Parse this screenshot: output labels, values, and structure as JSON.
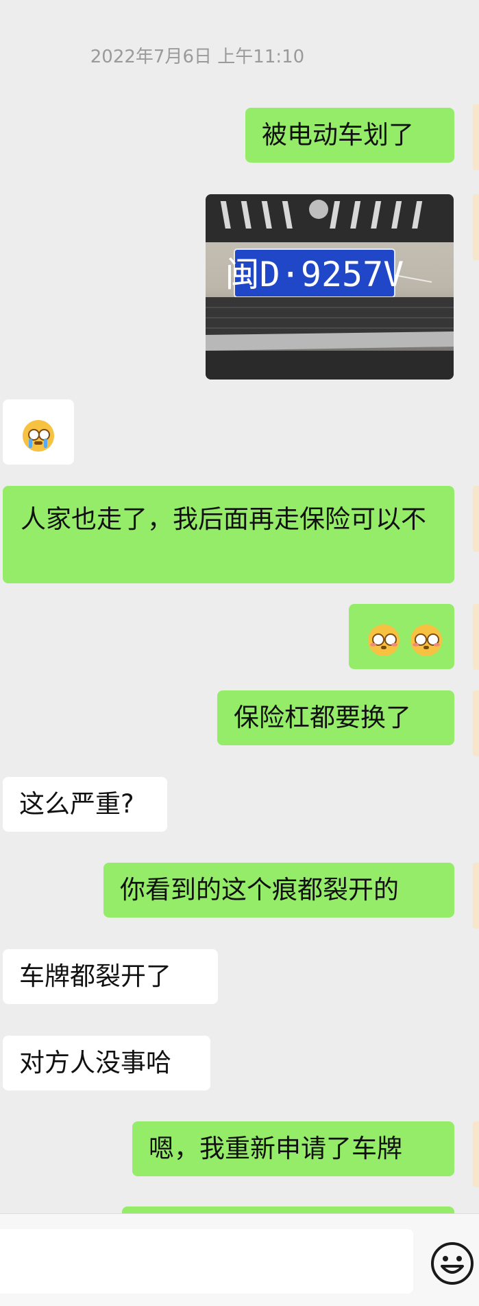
{
  "chat": {
    "timestamp": "2022年7月6日 上午11:10",
    "messages": [
      {
        "side": "out",
        "text": "被电动车划了"
      },
      {
        "side": "out",
        "type": "image",
        "plate_text": "闽D·9257V"
      },
      {
        "side": "in",
        "type": "emoji",
        "emoji_name": "crying-face-icon"
      },
      {
        "side": "out",
        "text": "人家也走了，我后面再走保险可以不"
      },
      {
        "side": "out",
        "type": "emoji",
        "emoji_name": "flushed-face-icon"
      },
      {
        "side": "out",
        "text": "保险杠都要换了"
      },
      {
        "side": "in",
        "text": "这么严重?"
      },
      {
        "side": "out",
        "text": "你看到的这个痕都裂开的"
      },
      {
        "side": "in",
        "text": "车牌都裂开了"
      },
      {
        "side": "in",
        "text": "对方人没事哈"
      },
      {
        "side": "out",
        "text": "嗯，我重新申请了车牌"
      }
    ]
  },
  "colors": {
    "background": "#ededed",
    "outgoing_bubble": "#95ec69",
    "incoming_bubble": "#ffffff",
    "timestamp_text": "#9a9a9a"
  },
  "input_bar": {
    "value": "",
    "emoji_button_icon": "smiley-face-icon"
  }
}
